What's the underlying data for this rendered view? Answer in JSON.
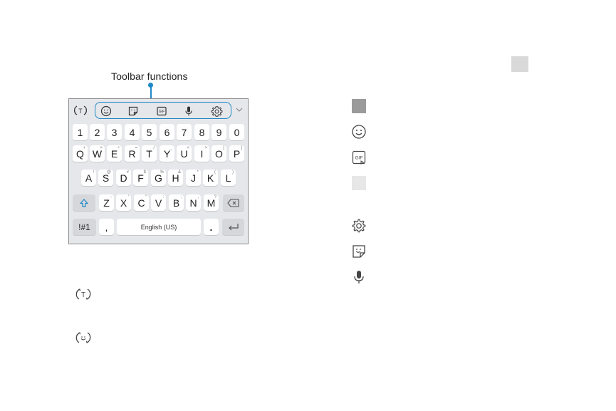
{
  "callout": {
    "label": "Toolbar functions"
  },
  "toolbar": {
    "icons": [
      "mode-switch-icon",
      "emoji-icon",
      "sticker-icon",
      "gif-icon",
      "microphone-icon",
      "gear-icon",
      "chevron-down-icon"
    ],
    "accent_color": "#1e88c7"
  },
  "keyboard": {
    "number_row": [
      "1",
      "2",
      "3",
      "4",
      "5",
      "6",
      "7",
      "8",
      "9",
      "0"
    ],
    "row1": [
      {
        "key": "Q",
        "sup": "+"
      },
      {
        "key": "W",
        "sup": "×"
      },
      {
        "key": "E",
        "sup": "÷"
      },
      {
        "key": "R",
        "sup": "="
      },
      {
        "key": "T",
        "sup": "/"
      },
      {
        "key": "Y",
        "sup": "_"
      },
      {
        "key": "U",
        "sup": "<"
      },
      {
        "key": "I",
        "sup": ">"
      },
      {
        "key": "O",
        "sup": "["
      },
      {
        "key": "P",
        "sup": "]"
      }
    ],
    "row2": [
      {
        "key": "A",
        "sup": "!"
      },
      {
        "key": "S",
        "sup": "@"
      },
      {
        "key": "D",
        "sup": "#"
      },
      {
        "key": "F",
        "sup": "$"
      },
      {
        "key": "G",
        "sup": "%"
      },
      {
        "key": "H",
        "sup": "&"
      },
      {
        "key": "J",
        "sup": "*"
      },
      {
        "key": "K",
        "sup": "("
      },
      {
        "key": "L",
        "sup": ")"
      }
    ],
    "row3": [
      {
        "key": "Z",
        "sup": "-"
      },
      {
        "key": "X",
        "sup": "'"
      },
      {
        "key": "C",
        "sup": "\""
      },
      {
        "key": "V",
        "sup": ":"
      },
      {
        "key": "B",
        "sup": ";"
      },
      {
        "key": "N",
        "sup": ","
      },
      {
        "key": "M",
        "sup": "?"
      }
    ],
    "symbols_key": "!#1",
    "comma_key": ",",
    "space_key": "English (US)",
    "period_key": "."
  },
  "legend_left": [
    "mode-switch-text-icon",
    "mode-switch-emoji-icon"
  ],
  "legend_right": [
    "grey-square-dark",
    "emoji-icon",
    "gif-icon",
    "grey-square-light",
    "gear-icon",
    "sticker-icon",
    "microphone-icon"
  ]
}
